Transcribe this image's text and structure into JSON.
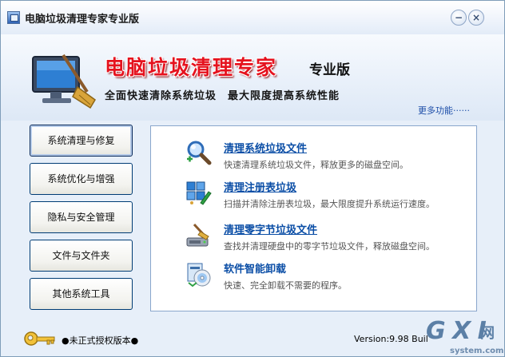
{
  "window": {
    "title": "电脑垃圾清理专家专业版",
    "minimize_glyph": "−",
    "close_glyph": "×"
  },
  "banner": {
    "title": "电脑垃圾清理专家",
    "edition": "专业版",
    "slogan": "全面快速清除系统垃圾　最大限度提高系统性能",
    "more_link": "更多功能······"
  },
  "sidebar": {
    "items": [
      {
        "label": "系统清理与修复",
        "active": true
      },
      {
        "label": "系统优化与增强",
        "active": false
      },
      {
        "label": "隐私与安全管理",
        "active": false
      },
      {
        "label": "文件与文件夹",
        "active": false
      },
      {
        "label": "其他系统工具",
        "active": false
      }
    ]
  },
  "panel": {
    "items": [
      {
        "title": "清理系统垃圾文件",
        "desc": "快速清理系统垃圾文件，释放更多的磁盘空间。",
        "icon": "magnifier-icon"
      },
      {
        "title": "清理注册表垃圾",
        "desc": "扫描并清除注册表垃圾，最大限度提升系统运行速度。",
        "icon": "registry-icon"
      },
      {
        "title": "清理零字节垃圾文件",
        "desc": "查找并清理硬盘中的零字节垃圾文件，释放磁盘空间。",
        "icon": "disk-broom-icon"
      },
      {
        "title": "软件智能卸载",
        "desc": "快速、完全卸载不需要的程序。",
        "icon": "uninstall-cd-icon"
      }
    ]
  },
  "footer": {
    "license_text": "●未正式授权版本●",
    "version_text": "Version:9.98  Buil"
  },
  "watermark": {
    "main": "G X I",
    "cn": "网",
    "sub": "system.com"
  },
  "colors": {
    "accent": "#0b4ea6",
    "title_red": "#e5121e",
    "window_bg": "#e7eff9"
  }
}
